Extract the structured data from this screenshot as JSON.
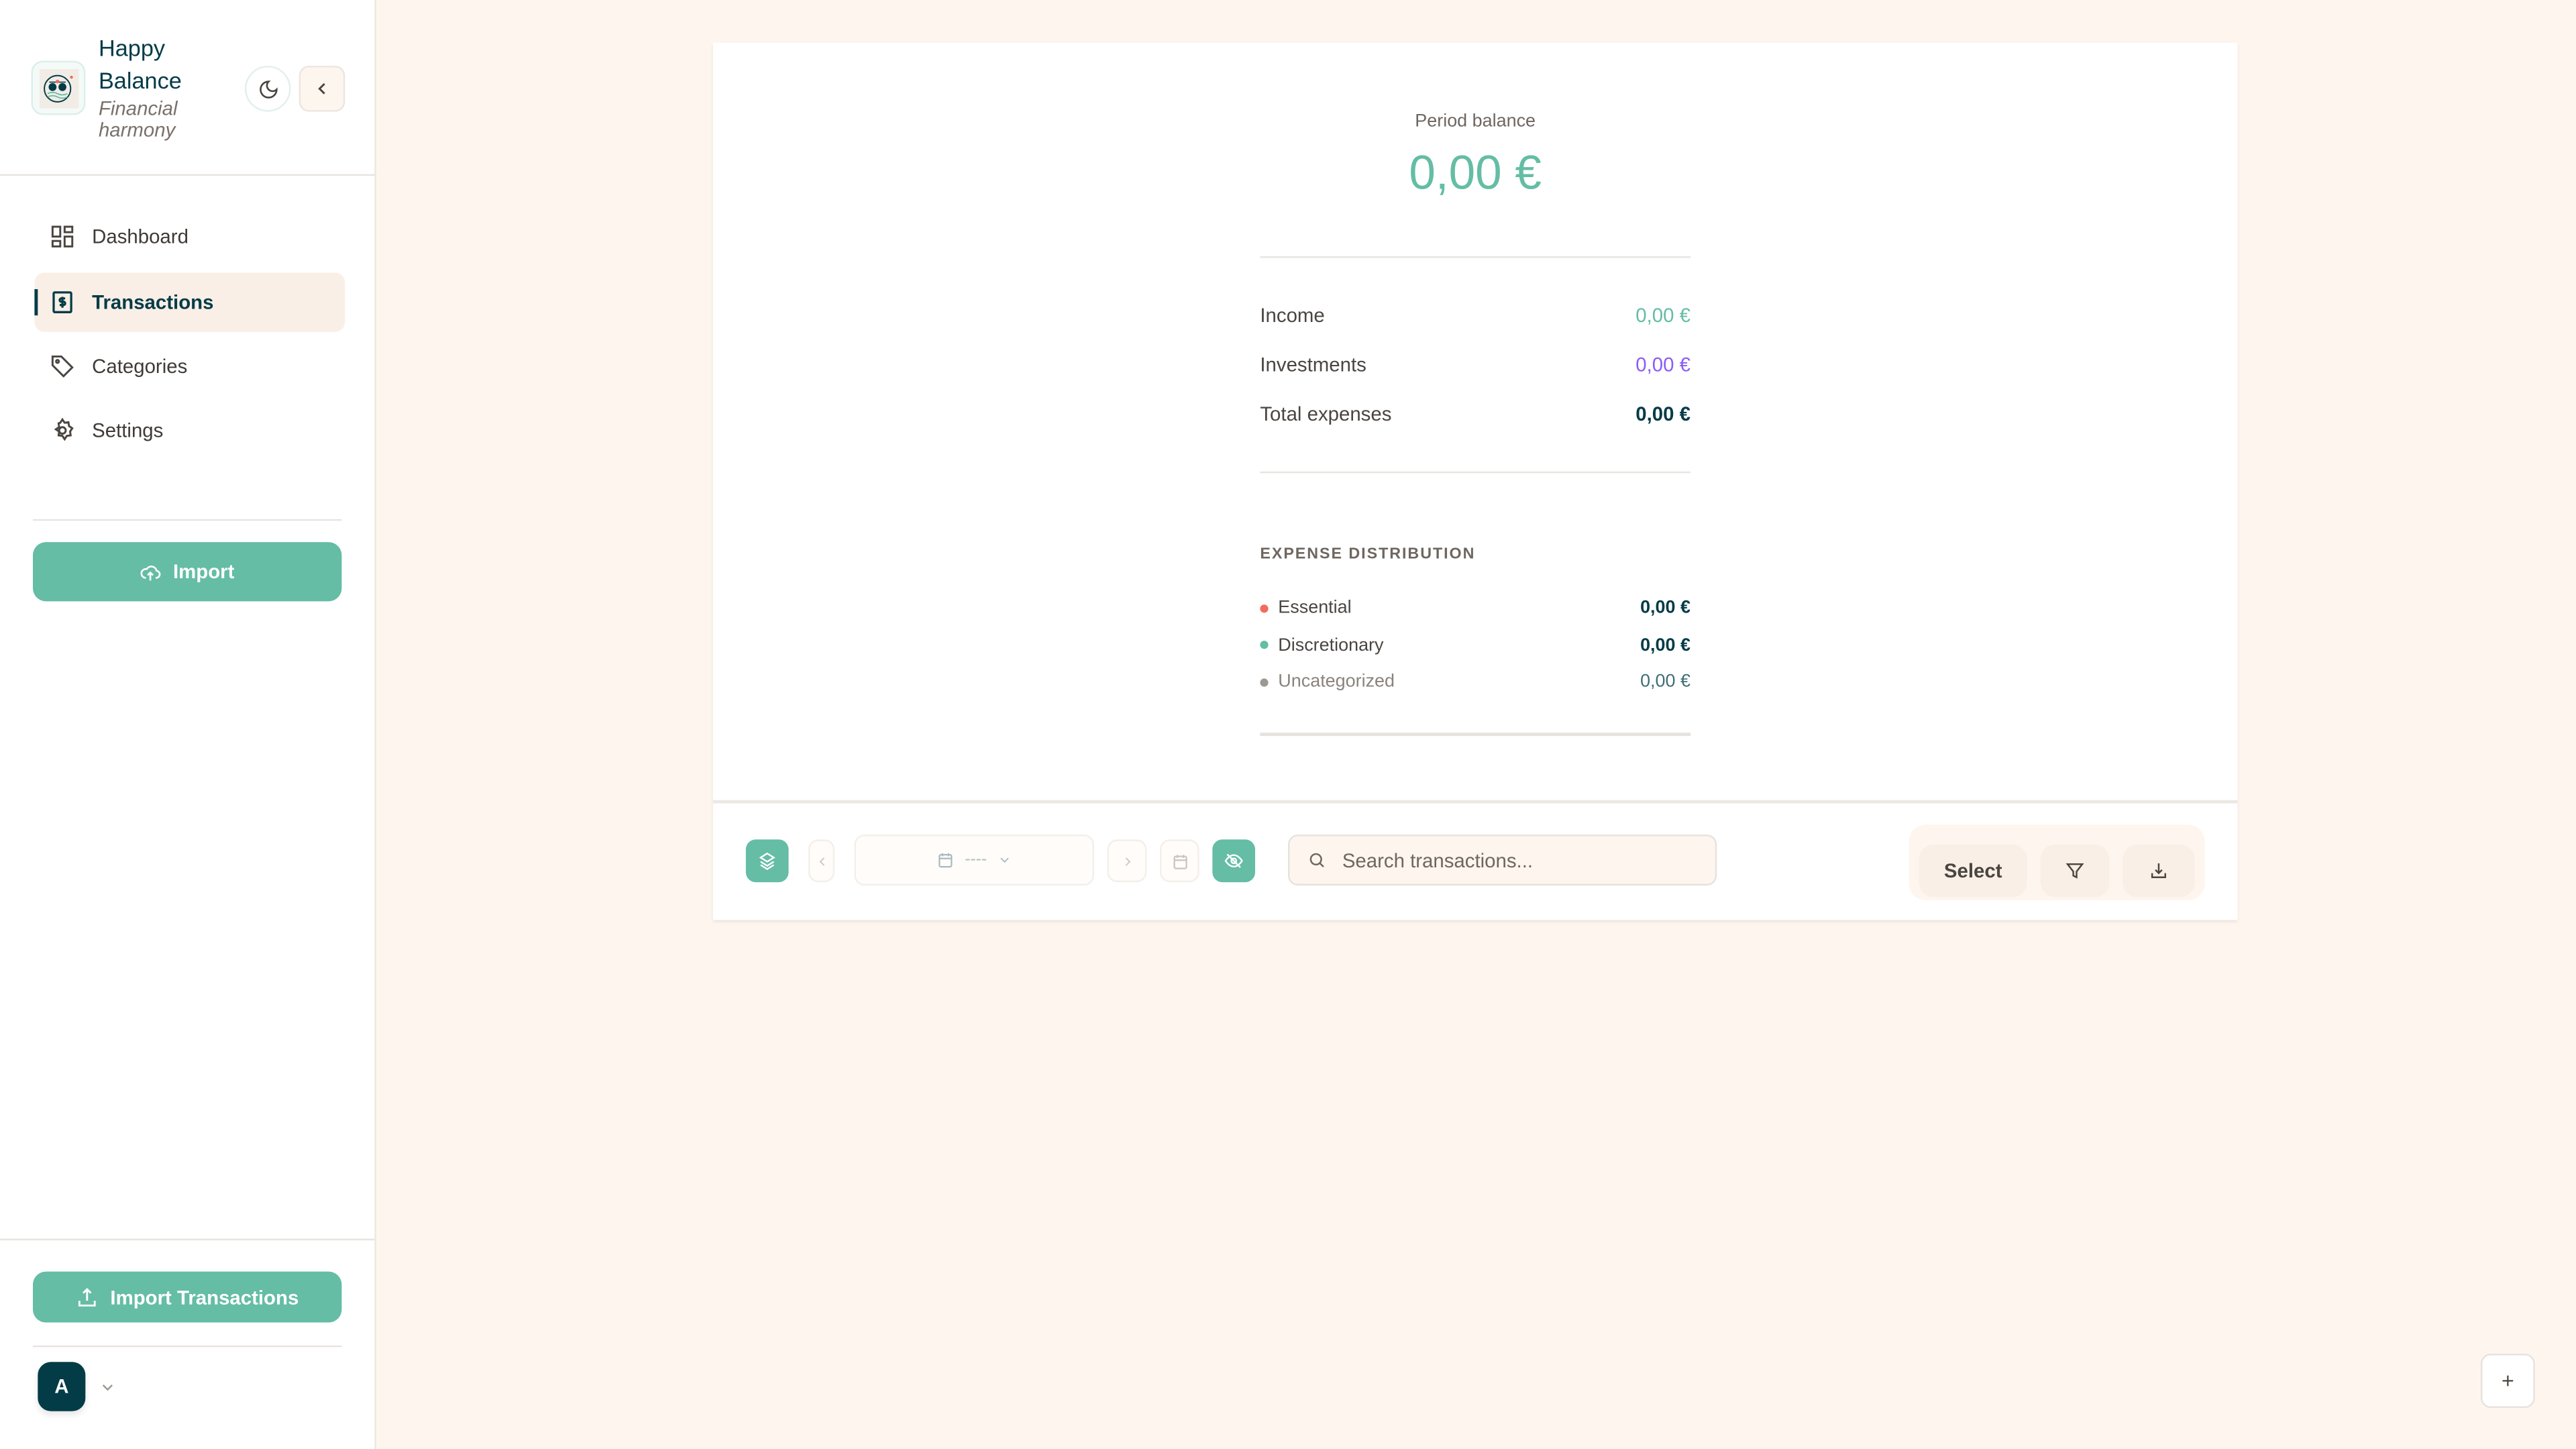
{
  "app": {
    "title": "Happy Balance",
    "subtitle": "Financial harmony"
  },
  "sidebar": {
    "items": [
      {
        "label": "Dashboard",
        "icon": "grid-icon"
      },
      {
        "label": "Transactions",
        "icon": "dollar-receipt-icon",
        "active": true
      },
      {
        "label": "Categories",
        "icon": "tag-icon"
      },
      {
        "label": "Settings",
        "icon": "gear-icon"
      }
    ],
    "import_label": "Import",
    "import_transactions_label": "Import Transactions",
    "avatar_initial": "A"
  },
  "summary": {
    "period_balance_label": "Period balance",
    "period_balance": "0,00 €",
    "rows": [
      {
        "label": "Income",
        "value": "0,00 €",
        "color": "#64bda4"
      },
      {
        "label": "Investments",
        "value": "0,00 €",
        "color": "#8b5cf6"
      },
      {
        "label": "Total expenses",
        "value": "0,00 €",
        "color": "#043b47"
      }
    ],
    "distribution_title": "EXPENSE DISTRIBUTION",
    "distribution": [
      {
        "label": "Essential",
        "value": "0,00 €",
        "dot": "#f26b5e"
      },
      {
        "label": "Discretionary",
        "value": "0,00 €",
        "dot": "#64bda4"
      },
      {
        "label": "Uncategorized",
        "value": "0,00 €",
        "dot": "#9e9893"
      }
    ]
  },
  "toolbar": {
    "date_value": "----",
    "search_placeholder": "Search transactions...",
    "select_label": "Select"
  },
  "colors": {
    "accent": "#64bda4",
    "brand_dark": "#043b47",
    "background": "#fef6ee"
  }
}
